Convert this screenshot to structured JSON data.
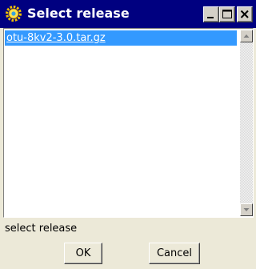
{
  "window": {
    "title": "Select release",
    "icon": "gear-icon",
    "controls": [
      "minimize-icon",
      "maximize-icon",
      "close-icon"
    ]
  },
  "list": {
    "items": [
      {
        "label": "otu-8kv2-3.0.tar.gz",
        "selected": true
      }
    ]
  },
  "status": {
    "text": "select release"
  },
  "buttons": {
    "ok_label": "OK",
    "cancel_label": "Cancel"
  },
  "colors": {
    "titlebar": "#000080",
    "selection": "#3399ff",
    "dialog_background": "#ece9d8"
  }
}
